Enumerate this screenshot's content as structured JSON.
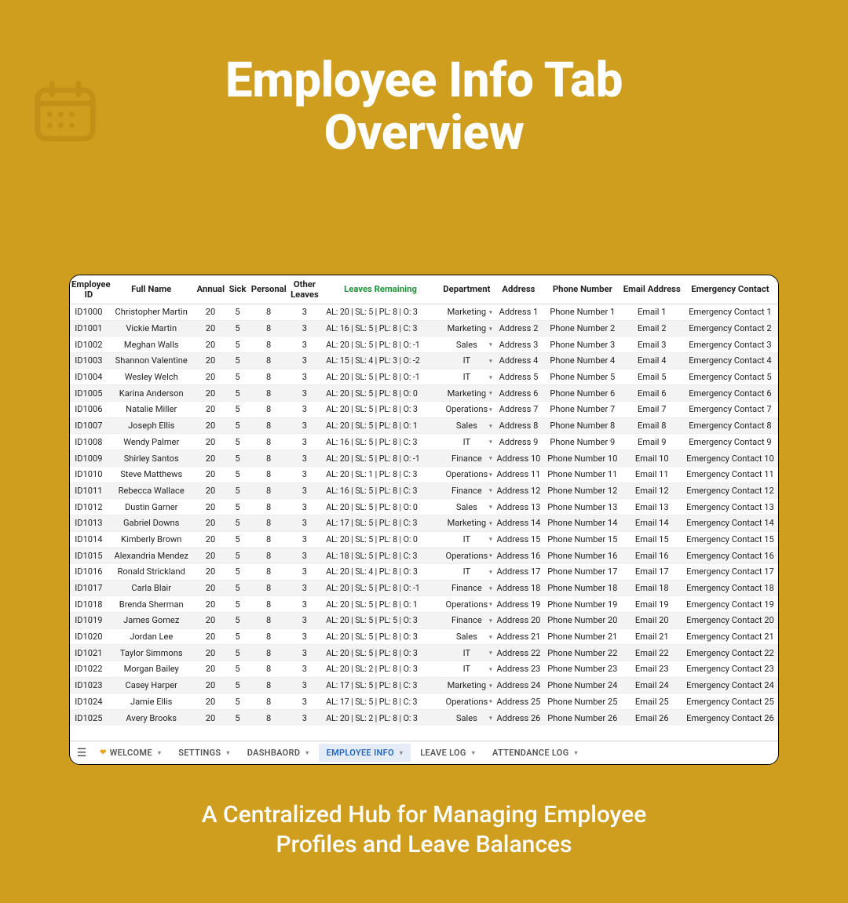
{
  "title_line1": "Employee Info Tab",
  "title_line2": "Overview",
  "subtitle_line1": "A Centralized Hub for Managing Employee",
  "subtitle_line2": "Profiles and Leave Balances",
  "columns": {
    "id": "Employee ID",
    "name": "Full Name",
    "annual": "Annual",
    "sick": "Sick",
    "personal": "Personal",
    "other": "Other Leaves",
    "remaining": "Leaves Remaining",
    "dept": "Department",
    "addr": "Address",
    "phone": "Phone Number",
    "email": "Email Address",
    "emerg": "Emergency Contact"
  },
  "tabs": {
    "welcome": "WELCOME",
    "settings": "SETTINGS",
    "dashboard": "DASHBAORD",
    "employee_info": "EMPLOYEE INFO",
    "leave_log": "LEAVE LOG",
    "attendance_log": "ATTENDANCE LOG"
  },
  "rows": [
    {
      "id": "ID1000",
      "name": "Christopher Martin",
      "annual": "20",
      "sick": "5",
      "personal": "8",
      "other": "3",
      "remaining": "AL: 20  |  SL: 5  |  PL: 8  |  O: 3",
      "dept": "Marketing",
      "addr": "Address 1",
      "phone": "Phone Number 1",
      "email": "Email 1",
      "emerg": "Emergency Contact 1"
    },
    {
      "id": "ID1001",
      "name": "Vickie Martin",
      "annual": "20",
      "sick": "5",
      "personal": "8",
      "other": "3",
      "remaining": "AL: 16  |  SL: 5  |  PL: 8  |  C: 3",
      "dept": "Marketing",
      "addr": "Address 2",
      "phone": "Phone Number 2",
      "email": "Email 2",
      "emerg": "Emergency Contact 2"
    },
    {
      "id": "ID1002",
      "name": "Meghan Walls",
      "annual": "20",
      "sick": "5",
      "personal": "8",
      "other": "3",
      "remaining": "AL: 20  |  SL: 5  |  PL: 8  |  O: -1",
      "dept": "Sales",
      "addr": "Address 3",
      "phone": "Phone Number 3",
      "email": "Email 3",
      "emerg": "Emergency Contact 3"
    },
    {
      "id": "ID1003",
      "name": "Shannon Valentine",
      "annual": "20",
      "sick": "5",
      "personal": "8",
      "other": "3",
      "remaining": "AL: 15  |  SL: 4  |  PL: 3  |  O: -2",
      "dept": "IT",
      "addr": "Address 4",
      "phone": "Phone Number 4",
      "email": "Email 4",
      "emerg": "Emergency Contact 4"
    },
    {
      "id": "ID1004",
      "name": "Wesley Welch",
      "annual": "20",
      "sick": "5",
      "personal": "8",
      "other": "3",
      "remaining": "AL: 20  |  SL: 5  |  PL: 8  |  O: -1",
      "dept": "IT",
      "addr": "Address 5",
      "phone": "Phone Number 5",
      "email": "Email 5",
      "emerg": "Emergency Contact 5"
    },
    {
      "id": "ID1005",
      "name": "Karina Anderson",
      "annual": "20",
      "sick": "5",
      "personal": "8",
      "other": "3",
      "remaining": "AL: 20  |  SL: 5  |  PL: 8  |  O: 0",
      "dept": "Marketing",
      "addr": "Address 6",
      "phone": "Phone Number 6",
      "email": "Email 6",
      "emerg": "Emergency Contact 6"
    },
    {
      "id": "ID1006",
      "name": "Natalie Miller",
      "annual": "20",
      "sick": "5",
      "personal": "8",
      "other": "3",
      "remaining": "AL: 20  |  SL: 5  |  PL: 8  |  O: 3",
      "dept": "Operations",
      "addr": "Address 7",
      "phone": "Phone Number 7",
      "email": "Email 7",
      "emerg": "Emergency Contact 7"
    },
    {
      "id": "ID1007",
      "name": "Joseph Ellis",
      "annual": "20",
      "sick": "5",
      "personal": "8",
      "other": "3",
      "remaining": "AL: 20  |  SL: 5  |  PL: 8  |  O: 1",
      "dept": "Sales",
      "addr": "Address 8",
      "phone": "Phone Number 8",
      "email": "Email 8",
      "emerg": "Emergency Contact 8"
    },
    {
      "id": "ID1008",
      "name": "Wendy Palmer",
      "annual": "20",
      "sick": "5",
      "personal": "8",
      "other": "3",
      "remaining": "AL: 16  |  SL: 5  |  PL: 8  |  C: 3",
      "dept": "IT",
      "addr": "Address 9",
      "phone": "Phone Number 9",
      "email": "Email 9",
      "emerg": "Emergency Contact 9"
    },
    {
      "id": "ID1009",
      "name": "Shirley Santos",
      "annual": "20",
      "sick": "5",
      "personal": "8",
      "other": "3",
      "remaining": "AL: 20  |  SL: 5  |  PL: 8  |  O: -1",
      "dept": "Finance",
      "addr": "Address 10",
      "phone": "Phone Number 10",
      "email": "Email 10",
      "emerg": "Emergency Contact 10"
    },
    {
      "id": "ID1010",
      "name": "Steve Matthews",
      "annual": "20",
      "sick": "5",
      "personal": "8",
      "other": "3",
      "remaining": "AL: 20  |  SL: 1  |  PL: 8  |  C: 3",
      "dept": "Operations",
      "addr": "Address 11",
      "phone": "Phone Number 11",
      "email": "Email 11",
      "emerg": "Emergency Contact 11"
    },
    {
      "id": "ID1011",
      "name": "Rebecca Wallace",
      "annual": "20",
      "sick": "5",
      "personal": "8",
      "other": "3",
      "remaining": "AL: 16  |  SL: 5  |  PL: 8  |  C: 3",
      "dept": "Finance",
      "addr": "Address 12",
      "phone": "Phone Number 12",
      "email": "Email 12",
      "emerg": "Emergency Contact 12"
    },
    {
      "id": "ID1012",
      "name": "Dustin Garner",
      "annual": "20",
      "sick": "5",
      "personal": "8",
      "other": "3",
      "remaining": "AL: 20  |  SL: 5  |  PL: 8  |  O: 0",
      "dept": "Sales",
      "addr": "Address 13",
      "phone": "Phone Number 13",
      "email": "Email 13",
      "emerg": "Emergency Contact 13"
    },
    {
      "id": "ID1013",
      "name": "Gabriel Downs",
      "annual": "20",
      "sick": "5",
      "personal": "8",
      "other": "3",
      "remaining": "AL: 17  |  SL: 5  |  PL: 8  |  C: 3",
      "dept": "Marketing",
      "addr": "Address 14",
      "phone": "Phone Number 14",
      "email": "Email 14",
      "emerg": "Emergency Contact 14"
    },
    {
      "id": "ID1014",
      "name": "Kimberly Brown",
      "annual": "20",
      "sick": "5",
      "personal": "8",
      "other": "3",
      "remaining": "AL: 20  |  SL: 5  |  PL: 8  |  O: 0",
      "dept": "IT",
      "addr": "Address 15",
      "phone": "Phone Number 15",
      "email": "Email 15",
      "emerg": "Emergency Contact 15"
    },
    {
      "id": "ID1015",
      "name": "Alexandria Mendez",
      "annual": "20",
      "sick": "5",
      "personal": "8",
      "other": "3",
      "remaining": "AL: 18  |  SL: 5  |  PL: 8  |  C: 3",
      "dept": "Operations",
      "addr": "Address 16",
      "phone": "Phone Number 16",
      "email": "Email 16",
      "emerg": "Emergency Contact 16"
    },
    {
      "id": "ID1016",
      "name": "Ronald Strickland",
      "annual": "20",
      "sick": "5",
      "personal": "8",
      "other": "3",
      "remaining": "AL: 20  |  SL: 4  |  PL: 8  |  O: 3",
      "dept": "IT",
      "addr": "Address 17",
      "phone": "Phone Number 17",
      "email": "Email 17",
      "emerg": "Emergency Contact 17"
    },
    {
      "id": "ID1017",
      "name": "Carla Blair",
      "annual": "20",
      "sick": "5",
      "personal": "8",
      "other": "3",
      "remaining": "AL: 20  |  SL: 5  |  PL: 8  |  O: -1",
      "dept": "Finance",
      "addr": "Address 18",
      "phone": "Phone Number 18",
      "email": "Email 18",
      "emerg": "Emergency Contact 18"
    },
    {
      "id": "ID1018",
      "name": "Brenda Sherman",
      "annual": "20",
      "sick": "5",
      "personal": "8",
      "other": "3",
      "remaining": "AL: 20  |  SL: 5  |  PL: 8  |  O: 1",
      "dept": "Operations",
      "addr": "Address 19",
      "phone": "Phone Number 19",
      "email": "Email 19",
      "emerg": "Emergency Contact 19"
    },
    {
      "id": "ID1019",
      "name": "James Gomez",
      "annual": "20",
      "sick": "5",
      "personal": "8",
      "other": "3",
      "remaining": "AL: 20  |  SL: 5  |  PL: 5  |  O: 3",
      "dept": "Finance",
      "addr": "Address 20",
      "phone": "Phone Number 20",
      "email": "Email 20",
      "emerg": "Emergency Contact 20"
    },
    {
      "id": "ID1020",
      "name": "Jordan Lee",
      "annual": "20",
      "sick": "5",
      "personal": "8",
      "other": "3",
      "remaining": "AL: 20  |  SL: 5  |  PL: 8  |  O: 3",
      "dept": "Sales",
      "addr": "Address 21",
      "phone": "Phone Number 21",
      "email": "Email 21",
      "emerg": "Emergency Contact 21"
    },
    {
      "id": "ID1021",
      "name": "Taylor Simmons",
      "annual": "20",
      "sick": "5",
      "personal": "8",
      "other": "3",
      "remaining": "AL: 20  |  SL: 5  |  PL: 8  |  O: 3",
      "dept": "IT",
      "addr": "Address 22",
      "phone": "Phone Number 22",
      "email": "Email 22",
      "emerg": "Emergency Contact 22"
    },
    {
      "id": "ID1022",
      "name": "Morgan Bailey",
      "annual": "20",
      "sick": "5",
      "personal": "8",
      "other": "3",
      "remaining": "AL: 20  |  SL: 2  |  PL: 8  |  O: 3",
      "dept": "IT",
      "addr": "Address 23",
      "phone": "Phone Number 23",
      "email": "Email 23",
      "emerg": "Emergency Contact 23"
    },
    {
      "id": "ID1023",
      "name": "Casey Harper",
      "annual": "20",
      "sick": "5",
      "personal": "8",
      "other": "3",
      "remaining": "AL: 17  |  SL: 5  |  PL: 8  |  C: 3",
      "dept": "Marketing",
      "addr": "Address 24",
      "phone": "Phone Number 24",
      "email": "Email 24",
      "emerg": "Emergency Contact 24"
    },
    {
      "id": "ID1024",
      "name": "Jamie Ellis",
      "annual": "20",
      "sick": "5",
      "personal": "8",
      "other": "3",
      "remaining": "AL: 17  |  SL: 5  |  PL: 8  |  C: 3",
      "dept": "Operations",
      "addr": "Address 25",
      "phone": "Phone Number 25",
      "email": "Email 25",
      "emerg": "Emergency Contact 25"
    },
    {
      "id": "ID1025",
      "name": "Avery Brooks",
      "annual": "20",
      "sick": "5",
      "personal": "8",
      "other": "3",
      "remaining": "AL: 20  |  SL: 2  |  PL: 8  |  O: 3",
      "dept": "Sales",
      "addr": "Address 26",
      "phone": "Phone Number 26",
      "email": "Email 26",
      "emerg": "Emergency Contact 26"
    }
  ],
  "chart_data": {
    "type": "table",
    "columns": [
      "Employee ID",
      "Full Name",
      "Annual",
      "Sick",
      "Personal",
      "Other Leaves",
      "Leaves Remaining",
      "Department",
      "Address",
      "Phone Number",
      "Email Address",
      "Emergency Contact"
    ],
    "note": "Row data stored under top-level key 'rows'."
  }
}
